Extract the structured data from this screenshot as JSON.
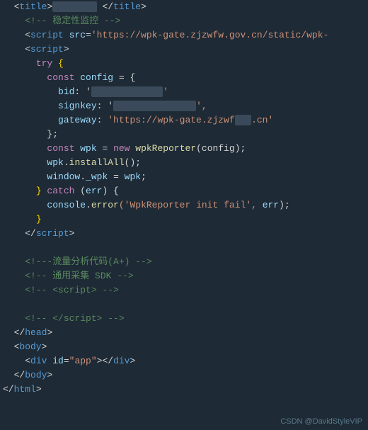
{
  "lines": [
    {
      "num": "",
      "parts": [
        {
          "text": "  <",
          "cls": "plain"
        },
        {
          "text": "title",
          "cls": "tag"
        },
        {
          "text": ">",
          "cls": "plain"
        },
        {
          "text": "        ",
          "cls": "blurred"
        },
        {
          "text": " </",
          "cls": "plain"
        },
        {
          "text": "title",
          "cls": "tag"
        },
        {
          "text": ">",
          "cls": "plain"
        }
      ]
    },
    {
      "num": "",
      "parts": [
        {
          "text": "    ",
          "cls": "plain"
        },
        {
          "text": "<!-- 稳定性监控 -->",
          "cls": "comment"
        }
      ]
    },
    {
      "num": "",
      "parts": [
        {
          "text": "    <",
          "cls": "plain"
        },
        {
          "text": "script",
          "cls": "tag"
        },
        {
          "text": " ",
          "cls": "plain"
        },
        {
          "text": "src",
          "cls": "attr-name"
        },
        {
          "text": "=",
          "cls": "plain"
        },
        {
          "text": "'https://wpk-gate.zjzwfw.gov.cn/static/wpk-",
          "cls": "attr-value"
        }
      ]
    },
    {
      "num": "",
      "parts": [
        {
          "text": "    <",
          "cls": "plain"
        },
        {
          "text": "script",
          "cls": "tag"
        },
        {
          "text": ">",
          "cls": "plain"
        }
      ]
    },
    {
      "num": "",
      "parts": [
        {
          "text": "      ",
          "cls": "plain"
        },
        {
          "text": "try",
          "cls": "keyword"
        },
        {
          "text": " {",
          "cls": "bracket"
        }
      ]
    },
    {
      "num": "",
      "parts": [
        {
          "text": "        ",
          "cls": "plain"
        },
        {
          "text": "const",
          "cls": "keyword"
        },
        {
          "text": " ",
          "cls": "plain"
        },
        {
          "text": "config",
          "cls": "var-name"
        },
        {
          "text": " = {",
          "cls": "plain"
        }
      ]
    },
    {
      "num": "",
      "parts": [
        {
          "text": "          ",
          "cls": "plain"
        },
        {
          "text": "bid",
          "cls": "var-name"
        },
        {
          "text": ": '",
          "cls": "plain"
        },
        {
          "text": "             ",
          "cls": "blurred"
        },
        {
          "text": "'",
          "cls": "string"
        }
      ]
    },
    {
      "num": "",
      "parts": [
        {
          "text": "          ",
          "cls": "plain"
        },
        {
          "text": "signkey",
          "cls": "var-name"
        },
        {
          "text": ": '",
          "cls": "plain"
        },
        {
          "text": "               ",
          "cls": "blurred"
        },
        {
          "text": "',",
          "cls": "string"
        }
      ]
    },
    {
      "num": "",
      "parts": [
        {
          "text": "          ",
          "cls": "plain"
        },
        {
          "text": "gateway",
          "cls": "var-name"
        },
        {
          "text": ": ",
          "cls": "plain"
        },
        {
          "text": "'https://wpk-gate.zjzwf",
          "cls": "string"
        },
        {
          "text": "   ",
          "cls": "blurred"
        },
        {
          "text": ".cn'",
          "cls": "string"
        }
      ]
    },
    {
      "num": "",
      "parts": [
        {
          "text": "        ",
          "cls": "plain"
        },
        {
          "text": "};",
          "cls": "plain"
        }
      ]
    },
    {
      "num": "",
      "parts": [
        {
          "text": "        ",
          "cls": "plain"
        },
        {
          "text": "const",
          "cls": "keyword"
        },
        {
          "text": " ",
          "cls": "plain"
        },
        {
          "text": "wpk",
          "cls": "var-name"
        },
        {
          "text": " = ",
          "cls": "plain"
        },
        {
          "text": "new",
          "cls": "keyword"
        },
        {
          "text": " ",
          "cls": "plain"
        },
        {
          "text": "wpkReporter",
          "cls": "function-name"
        },
        {
          "text": "(config);",
          "cls": "plain"
        }
      ]
    },
    {
      "num": "",
      "parts": [
        {
          "text": "        ",
          "cls": "plain"
        },
        {
          "text": "wpk",
          "cls": "var-name"
        },
        {
          "text": ".",
          "cls": "plain"
        },
        {
          "text": "installAll",
          "cls": "function-name"
        },
        {
          "text": "();",
          "cls": "plain"
        }
      ]
    },
    {
      "num": "",
      "parts": [
        {
          "text": "        ",
          "cls": "plain"
        },
        {
          "text": "window",
          "cls": "var-name"
        },
        {
          "text": ".",
          "cls": "plain"
        },
        {
          "text": "_wpk",
          "cls": "var-name"
        },
        {
          "text": " = ",
          "cls": "plain"
        },
        {
          "text": "wpk",
          "cls": "var-name"
        },
        {
          "text": ";",
          "cls": "plain"
        }
      ]
    },
    {
      "num": "",
      "parts": [
        {
          "text": "      ",
          "cls": "plain"
        },
        {
          "text": "} ",
          "cls": "bracket"
        },
        {
          "text": "catch",
          "cls": "keyword"
        },
        {
          "text": " (",
          "cls": "plain"
        },
        {
          "text": "err",
          "cls": "var-name"
        },
        {
          "text": ") {",
          "cls": "plain"
        }
      ]
    },
    {
      "num": "",
      "parts": [
        {
          "text": "        ",
          "cls": "plain"
        },
        {
          "text": "console",
          "cls": "var-name"
        },
        {
          "text": ".",
          "cls": "plain"
        },
        {
          "text": "error",
          "cls": "function-name"
        },
        {
          "text": "('WpkReporter init fail', ",
          "cls": "string"
        },
        {
          "text": "err",
          "cls": "var-name"
        },
        {
          "text": ");",
          "cls": "plain"
        }
      ]
    },
    {
      "num": "",
      "parts": [
        {
          "text": "      ",
          "cls": "plain"
        },
        {
          "text": "}",
          "cls": "bracket"
        }
      ]
    },
    {
      "num": "",
      "parts": [
        {
          "text": "    </",
          "cls": "plain"
        },
        {
          "text": "script",
          "cls": "tag"
        },
        {
          "text": ">",
          "cls": "plain"
        }
      ]
    },
    {
      "num": "",
      "parts": [
        {
          "text": "    ",
          "cls": "plain"
        }
      ]
    },
    {
      "num": "",
      "parts": [
        {
          "text": "    <!---流量分析代码(A+) -->",
          "cls": "comment"
        }
      ]
    },
    {
      "num": "",
      "parts": [
        {
          "text": "    <!-- 通用采集 SDK -->",
          "cls": "comment"
        }
      ]
    },
    {
      "num": "",
      "parts": [
        {
          "text": "    <!-- <",
          "cls": "comment"
        },
        {
          "text": "script",
          "cls": "comment"
        },
        {
          "text": "> -->",
          "cls": "comment"
        }
      ]
    },
    {
      "num": "",
      "parts": [
        {
          "text": "    ",
          "cls": "plain"
        }
      ]
    },
    {
      "num": "",
      "parts": [
        {
          "text": "    <!-- </",
          "cls": "comment"
        },
        {
          "text": "script",
          "cls": "comment"
        },
        {
          "text": "> -->",
          "cls": "comment"
        }
      ]
    },
    {
      "num": "",
      "parts": [
        {
          "text": "  </",
          "cls": "plain"
        },
        {
          "text": "head",
          "cls": "tag"
        },
        {
          "text": ">",
          "cls": "plain"
        }
      ]
    },
    {
      "num": "",
      "parts": [
        {
          "text": "  <",
          "cls": "plain"
        },
        {
          "text": "body",
          "cls": "tag"
        },
        {
          "text": ">",
          "cls": "plain"
        }
      ]
    },
    {
      "num": "",
      "parts": [
        {
          "text": "    <",
          "cls": "plain"
        },
        {
          "text": "div",
          "cls": "tag"
        },
        {
          "text": " ",
          "cls": "plain"
        },
        {
          "text": "id",
          "cls": "attr-name"
        },
        {
          "text": "=",
          "cls": "plain"
        },
        {
          "text": "\"app\"",
          "cls": "attr-value"
        },
        {
          "text": "></",
          "cls": "plain"
        },
        {
          "text": "div",
          "cls": "tag"
        },
        {
          "text": ">",
          "cls": "plain"
        }
      ]
    },
    {
      "num": "",
      "parts": [
        {
          "text": "  </",
          "cls": "plain"
        },
        {
          "text": "body",
          "cls": "tag"
        },
        {
          "text": ">",
          "cls": "plain"
        }
      ]
    },
    {
      "num": "",
      "parts": [
        {
          "text": "</",
          "cls": "plain"
        },
        {
          "text": "html",
          "cls": "tag"
        },
        {
          "text": ">",
          "cls": "plain"
        }
      ]
    }
  ],
  "watermark": "CSDN @DavidStyleVIP"
}
